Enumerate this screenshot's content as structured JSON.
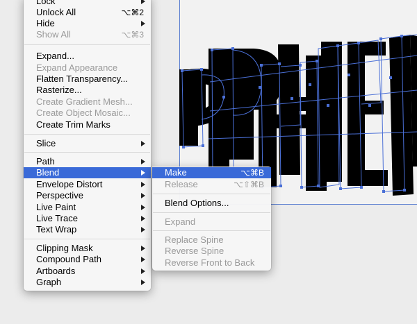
{
  "main_menu": {
    "items": [
      {
        "label": "Lock",
        "submenu": true,
        "disabled": false
      },
      {
        "label": "Unlock All",
        "shortcut": "⌥⌘2",
        "disabled": false
      },
      {
        "label": "Hide",
        "submenu": true,
        "disabled": false
      },
      {
        "label": "Show All",
        "shortcut": "⌥⌘3",
        "disabled": true
      },
      {
        "label": "Expand...",
        "disabled": false
      },
      {
        "label": "Expand Appearance",
        "disabled": true
      },
      {
        "label": "Flatten Transparency...",
        "disabled": false
      },
      {
        "label": "Rasterize...",
        "disabled": false
      },
      {
        "label": "Create Gradient Mesh...",
        "disabled": true
      },
      {
        "label": "Create Object Mosaic...",
        "disabled": true
      },
      {
        "label": "Create Trim Marks",
        "disabled": false
      },
      {
        "label": "Slice",
        "submenu": true,
        "disabled": false
      },
      {
        "label": "Path",
        "submenu": true,
        "disabled": false
      },
      {
        "label": "Blend",
        "submenu": true,
        "disabled": false,
        "active": true
      },
      {
        "label": "Envelope Distort",
        "submenu": true,
        "disabled": false
      },
      {
        "label": "Perspective",
        "submenu": true,
        "disabled": false
      },
      {
        "label": "Live Paint",
        "submenu": true,
        "disabled": false
      },
      {
        "label": "Live Trace",
        "submenu": true,
        "disabled": false
      },
      {
        "label": "Text Wrap",
        "submenu": true,
        "disabled": false
      },
      {
        "label": "Clipping Mask",
        "submenu": true,
        "disabled": false
      },
      {
        "label": "Compound Path",
        "submenu": true,
        "disabled": false
      },
      {
        "label": "Artboards",
        "submenu": true,
        "disabled": false
      },
      {
        "label": "Graph",
        "submenu": true,
        "disabled": false
      }
    ]
  },
  "blend_submenu": {
    "items": [
      {
        "label": "Make",
        "shortcut": "⌥⌘B",
        "active": true,
        "disabled": false
      },
      {
        "label": "Release",
        "shortcut": "⌥⇧⌘B",
        "disabled": true
      },
      {
        "label": "Blend Options...",
        "disabled": false
      },
      {
        "label": "Expand",
        "disabled": true
      },
      {
        "label": "Replace Spine",
        "disabled": true
      },
      {
        "label": "Reverse Spine",
        "disabled": true
      },
      {
        "label": "Reverse Front to Back",
        "disabled": true
      }
    ]
  },
  "colors": {
    "highlight": "#3a6ad8",
    "selection": "#4a6fd6",
    "disabled_text": "#9a9a9a"
  }
}
